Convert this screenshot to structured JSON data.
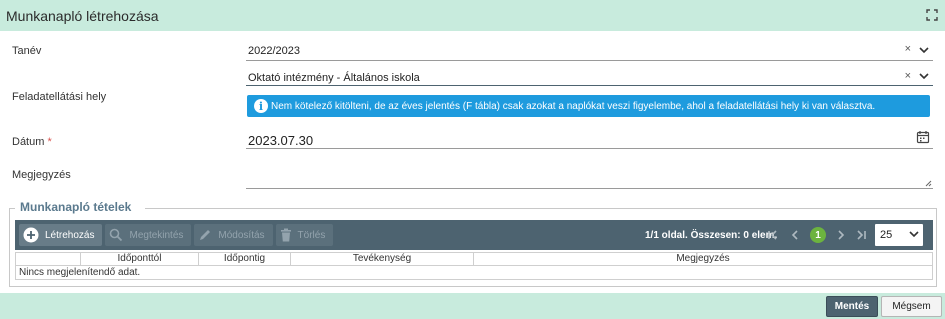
{
  "dialog": {
    "title": "Munkanapló létrehozása",
    "maximize_icon": "maximize-icon"
  },
  "form": {
    "tanev_label": "Tanév",
    "tanev_value": "2022/2023",
    "feladat_label": "Feladatellátási hely",
    "feladat_value": "Oktató intézmény - Általános iskola",
    "info_text": "Nem kötelező kitölteni, de az éves jelentés (F tábla) csak azokat a naplókat veszi figyelembe, ahol a feladatellátási hely ki van választva.",
    "info_icon_glyph": "i",
    "datum_label": "Dátum",
    "datum_required": "*",
    "datum_value": "2023.07.30",
    "megj_label": "Megjegyzés",
    "megj_value": "",
    "clear_glyph": "×"
  },
  "items_section": {
    "title": "Munkanapló tételek",
    "toolbar": {
      "create": "Létrehozás",
      "view": "Megtekintés",
      "edit": "Módosítás",
      "delete": "Törlés"
    },
    "pager": {
      "summary": "1/1 oldal. Összesen: 0 elem.",
      "current_page": "1",
      "page_size": "25"
    },
    "columns": [
      "Időponttól",
      "Időpontig",
      "Tevékenység",
      "Megjegyzés"
    ],
    "empty_text": "Nincs megjelenítendő adat."
  },
  "footer": {
    "save": "Mentés",
    "cancel": "Mégsem"
  },
  "colors": {
    "header_bg": "#c8ebdd",
    "toolbar_bg": "#4d6370",
    "info_bg": "#1e9bde",
    "page_active": "#6cb33f"
  }
}
